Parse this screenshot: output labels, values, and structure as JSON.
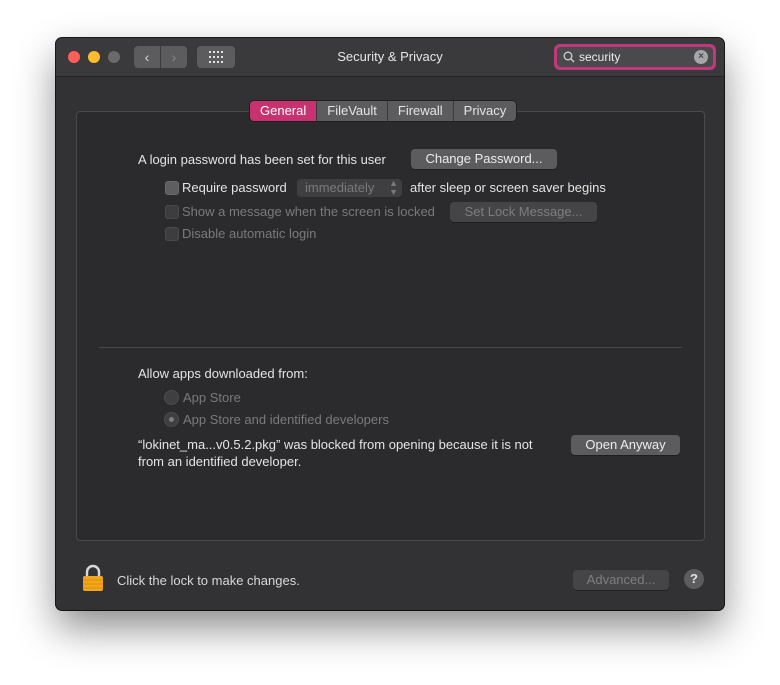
{
  "window": {
    "title": "Security & Privacy"
  },
  "toolbar": {
    "back_label": "‹",
    "forward_label": "›",
    "search_value": "security",
    "search_clear": "×"
  },
  "tabs": [
    {
      "label": "General",
      "active": true
    },
    {
      "label": "FileVault",
      "active": false
    },
    {
      "label": "Firewall",
      "active": false
    },
    {
      "label": "Privacy",
      "active": false
    }
  ],
  "general": {
    "login_text": "A login password has been set for this user",
    "change_password_label": "Change Password...",
    "require_password_label": "Require password",
    "require_password_value": "immediately",
    "after_sleep_text": "after sleep or screen saver begins",
    "show_message_label": "Show a message when the screen is locked",
    "set_lock_message_label": "Set Lock Message...",
    "disable_login_label": "Disable automatic login"
  },
  "apps": {
    "heading": "Allow apps downloaded from:",
    "options": [
      {
        "label": "App Store",
        "selected": false
      },
      {
        "label": "App Store and identified developers",
        "selected": true
      }
    ],
    "blocked_line1": "“lokinet_ma...v0.5.2.pkg” was blocked from opening because it is not",
    "blocked_line2": "from an identified developer.",
    "open_anyway_label": "Open Anyway"
  },
  "footer": {
    "lock_text": "Click the lock to make changes.",
    "advanced_label": "Advanced...",
    "help_label": "?"
  },
  "colors": {
    "accent": "#c8336f",
    "window_bg": "#323234",
    "panel_bg": "#2b2b2d"
  }
}
